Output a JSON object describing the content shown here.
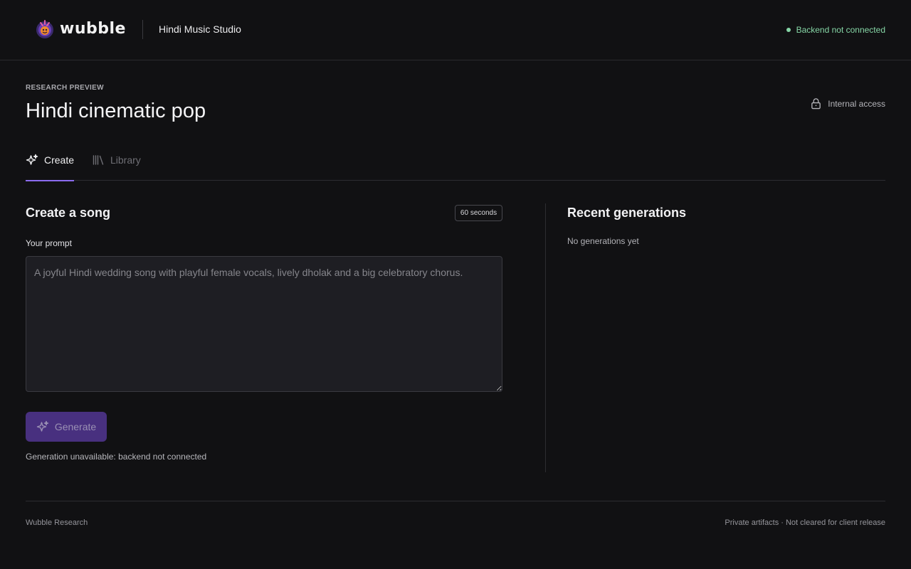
{
  "header": {
    "logo_text": "wubble",
    "studio_title": "Hindi Music Studio",
    "backend_status": "Backend not connected",
    "status_color": "#86d6a6"
  },
  "page": {
    "eyebrow": "RESEARCH PREVIEW",
    "title": "Hindi cinematic pop",
    "access_label": "Internal access",
    "access_icon": "lock-icon"
  },
  "tabs": [
    {
      "label": "Create",
      "icon": "sparkle-icon",
      "active": true
    },
    {
      "label": "Library",
      "icon": "library-icon",
      "active": false
    }
  ],
  "create": {
    "heading": "Create a song",
    "duration_badge": "60 seconds",
    "prompt_label": "Your prompt",
    "prompt_placeholder": "A joyful Hindi wedding song with playful female vocals, lively dholak and a big celebratory chorus.",
    "prompt_value": "",
    "generate_label": "Generate",
    "generate_enabled": false,
    "unavailable_text": "Generation unavailable: backend not connected"
  },
  "recent": {
    "heading": "Recent generations",
    "empty_text": "No generations yet"
  },
  "footer": {
    "left": "Wubble Research",
    "right": "Private artifacts · Not cleared for client release"
  },
  "colors": {
    "accent": "#8b6cf0",
    "button_bg": "#48307f",
    "background": "#111113"
  }
}
